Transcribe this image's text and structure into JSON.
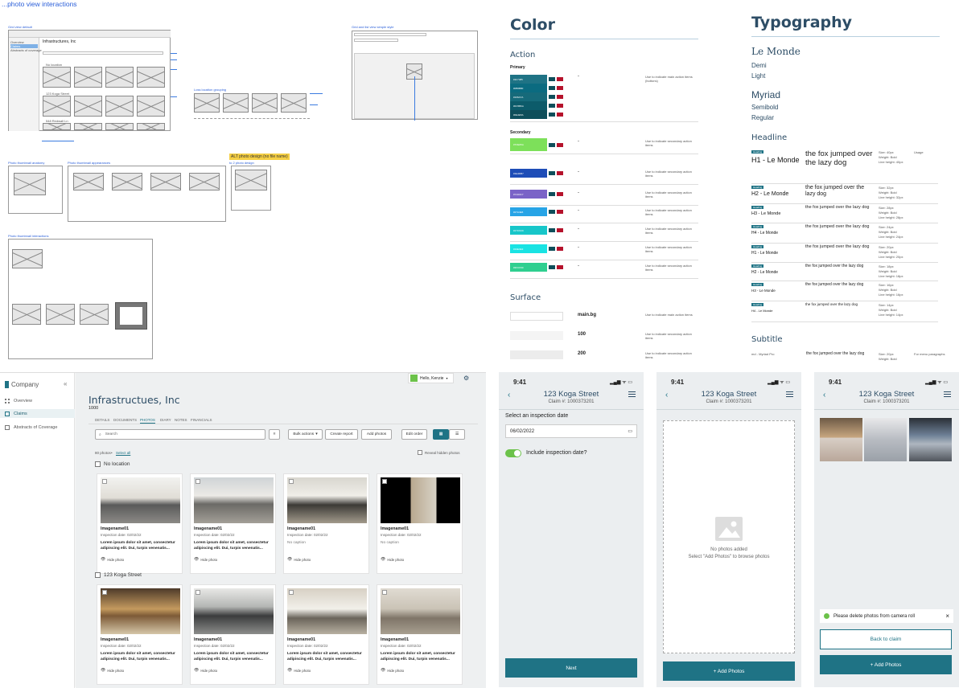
{
  "top_left": {
    "title_link": "...photo view interactions",
    "grid_view_label": "Grid view default",
    "list_view_label": "Grid and list view simple style",
    "location_grouping_label": "Loss location grouping",
    "alt_photo_label": "ALT photo design (no file name)",
    "alt_photo_sublabel": "to 2 photo design",
    "anatomy_label": "Photo thumbnail anatomy",
    "appearances_label": "Photo thumbnail appearances",
    "interactions_label": "Photo thumbnail interactions",
    "wf_claim_title": "Infrastructures, Inc",
    "wf_sidebar_items": [
      "Overview",
      "Claims",
      "Abstracts of coverage"
    ],
    "wf_groups": [
      "No location",
      "123 Koga Street",
      "548 Redwall Ln"
    ]
  },
  "style_guide": {
    "color_title": "Color",
    "action_label": "Action",
    "primary_label": "Primary",
    "secondary_label": "Secondary",
    "surface_label": "Surface",
    "usage_text": "Use to indicate main action items (buttons)",
    "secondary_usage_text": "Use to indicate secondary action items",
    "primary_swatches": [
      "#1F7385",
      "#0B6B80",
      "#166A7A",
      "#0C5B6A",
      "#0E4E5A"
    ],
    "secondary_swatches": [
      "#7DE05A",
      "#1E4DB7",
      "#7A63C7",
      "#27A4E6",
      "#17C6C9",
      "#19E3E3",
      "#2FCF90"
    ],
    "surface_rows": [
      {
        "name": "main.bg",
        "usage": "Use to indicate main action items"
      },
      {
        "name": "100",
        "usage": "Use to indicate secondary action items"
      },
      {
        "name": "200",
        "usage": "Use to indicate secondary action items"
      }
    ],
    "typography_title": "Typography",
    "fonts": [
      {
        "name": "Le Monde",
        "weights": [
          "Demi",
          "Light"
        ]
      },
      {
        "name": "Myriad",
        "weights": [
          "Semibold",
          "Regular"
        ]
      }
    ],
    "headline_label": "Headline",
    "usage_col": "Usage",
    "sample_text": "the fox jumped over the lazy dog",
    "headline_rows": [
      {
        "tag": "Heading",
        "name": "H1 - Le Monde",
        "size": "Size: 40px",
        "weight": "Weight: Bold",
        "lh": "Line height: 40px"
      },
      {
        "tag": "Heading",
        "name": "H2 - Le Monde",
        "size": "Size: 32px",
        "weight": "Weight: Bold",
        "lh": "Line height: 32px"
      },
      {
        "tag": "Heading",
        "name": "H3 - Le Monde",
        "size": "Size: 28px",
        "weight": "Weight: Bold",
        "lh": "Line height: 28px"
      },
      {
        "tag": "Heading",
        "name": "H4 - Le Monde",
        "size": "Size: 24px",
        "weight": "Weight: Bold",
        "lh": "Line height: 24px"
      },
      {
        "tag": "Heading",
        "name": "H1 - Le Monde",
        "size": "Size: 20px",
        "weight": "Weight: Bold",
        "lh": "Line height: 20px"
      },
      {
        "tag": "Heading",
        "name": "H2 - Le Monde",
        "size": "Size: 18px",
        "weight": "Weight: Bold",
        "lh": "Line height: 18px"
      },
      {
        "tag": "Heading",
        "name": "H3 - Le Monde",
        "size": "Size: 16px",
        "weight": "Weight: Bold",
        "lh": "Line height: 16px"
      },
      {
        "tag": "Heading",
        "name": "H4 - Le Monde",
        "size": "Size: 14px",
        "weight": "Weight: Bold",
        "lh": "Line height: 14px"
      }
    ],
    "subtitle_label": "Subtitle",
    "subtitle_row": {
      "name": "md - Myriad Pro",
      "size": "Size: 20px",
      "weight": "Weight: Bold",
      "usage": "For menu paragraphs"
    }
  },
  "app": {
    "brand": "Company",
    "collapse_icon": "«",
    "nav": [
      "Overview",
      "Claims",
      "Abstracts of Coverage"
    ],
    "user_label": "Hello, Kenzie",
    "title": "Infrastructues, Inc",
    "subtitle": "1000",
    "tabs": [
      "DETAILS",
      "DOCUMENTS",
      "PHOTOS",
      "DIARY",
      "NOTES",
      "FINANCIALS"
    ],
    "search_placeholder": "Search",
    "bulk_actions": "Bulk actions",
    "create_report": "Create report",
    "add_photos": "Add photos",
    "edit_order": "Edit order",
    "photo_count": "80 photos",
    "select_all": "Select all",
    "reveal_hidden": "Reveal hidden photos",
    "groups": [
      {
        "name": "No location",
        "cards": [
          {
            "name": "Imagename01",
            "date": "Inspection date: 02/02/22",
            "caption": "Lorem ipsum dolor sit amet, consectetur adipiscing elit. Dui, turpis venenatis...",
            "action": "Hide photo"
          },
          {
            "name": "Imagename01",
            "date": "Inspection date: 02/02/22",
            "caption": "Lorem ipsum dolor sit amet, consectetur adipiscing elit. Dui, turpis venenatis...",
            "action": "Hide photo"
          },
          {
            "name": "Imagename01",
            "date": "Inspection date: 02/02/22",
            "caption": "No caption",
            "action": "Hide photo"
          },
          {
            "name": "Imagename01",
            "date": "Inspection date: 02/02/22",
            "caption": "No caption",
            "action": "Hide photo"
          }
        ]
      },
      {
        "name": "123 Koga Street",
        "cards": [
          {
            "name": "Imagename01",
            "date": "Inspection date: 02/02/22",
            "caption": "Lorem ipsum dolor sit amet, consectetur adipiscing elit. Dui, turpis venenatis...",
            "action": "Hide photo"
          },
          {
            "name": "Imagename01",
            "date": "Inspection date: 02/02/22",
            "caption": "Lorem ipsum dolor sit amet, consectetur adipiscing elit. Dui, turpis venenatis...",
            "action": "Hide photo"
          },
          {
            "name": "Imagename01",
            "date": "Inspection date: 02/02/22",
            "caption": "Lorem ipsum dolor sit amet, consectetur adipiscing elit. Dui, turpis venenatis...",
            "action": "Hide photo"
          },
          {
            "name": "Imagename01",
            "date": "Inspection date: 02/02/22",
            "caption": "Lorem ipsum dolor sit amet, consectetur adipiscing elit. Dui, turpis venenatis...",
            "action": "Hide photo"
          }
        ]
      }
    ]
  },
  "phones": {
    "time": "9:41",
    "signal": "▂▄▆ ᯤ ▭",
    "address": "123 Koga Street",
    "claim": "Claim #: 1000373201",
    "p1": {
      "label": "Select an inspection date",
      "date_value": "06/02/2022",
      "toggle_label": "Include inspection date?",
      "next": "Next"
    },
    "p2": {
      "empty_title": "No photos added",
      "empty_sub": "Select \"Add Photos\" to browse photos",
      "add": "+ Add Photos"
    },
    "p3": {
      "toast": "Please delete photos from camera roll",
      "back": "Back to claim",
      "add": "+ Add Photos"
    }
  }
}
